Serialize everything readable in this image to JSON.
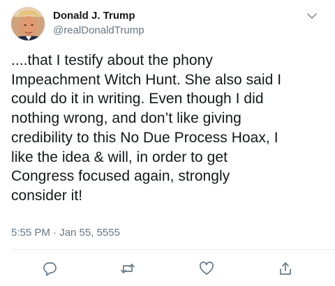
{
  "author": {
    "name": "Donald J. Trump",
    "handle": "@realDonaldTrump",
    "avatar_icon": "profile-photo"
  },
  "tweet": {
    "text": "....that I testify about the phony\nImpeachment Witch Hunt. She also said I\ncould do it in writing. Even though I did\nnothing wrong, and don’t like giving\ncredibility to this No Due Process Hoax, I\nlike the idea & will, in order to get\nCongress focused again, strongly\nconsider it!",
    "timestamp": "5:55 PM · Jan 55, 5555"
  },
  "actions": {
    "reply_icon": "speech-bubble-icon",
    "retweet_icon": "retweet-arrows-icon",
    "like_icon": "heart-icon",
    "share_icon": "share-upload-icon"
  },
  "colors": {
    "text": "#14171a",
    "secondary": "#657786",
    "icon": "#657786",
    "divider": "#e6ecf0"
  }
}
